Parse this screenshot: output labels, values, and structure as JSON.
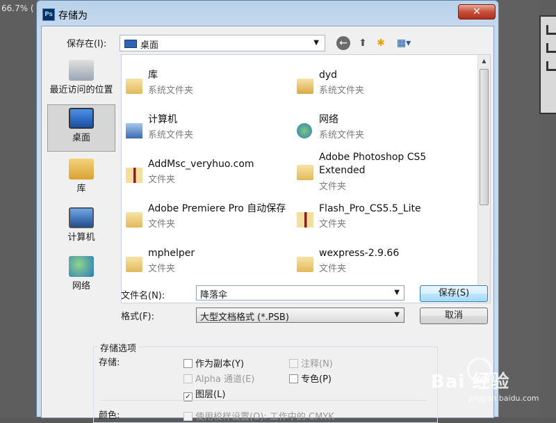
{
  "background": {
    "zoom_text": "66.7% (",
    "colors": {
      "ps_bg": "#5e5e5e"
    }
  },
  "dialog": {
    "icon_text": "Ps",
    "title": "存储为",
    "close_glyph": "✕",
    "save_in": {
      "label": "保存在(I):",
      "value": "桌面",
      "arrow": "▼"
    },
    "nav": {
      "back": "←",
      "up": "⬆",
      "new_folder": "✱",
      "views": "▦▾"
    },
    "places": [
      {
        "label": "最近访问的位置",
        "icon": "recent-places-icon"
      },
      {
        "label": "桌面",
        "icon": "desktop-icon",
        "active": true
      },
      {
        "label": "库",
        "icon": "library-icon"
      },
      {
        "label": "计算机",
        "icon": "computer-icon"
      },
      {
        "label": "网络",
        "icon": "network-icon"
      }
    ],
    "files": [
      {
        "name": "库",
        "type": "系统文件夹",
        "icon": "library-folder-icon"
      },
      {
        "name": "dyd",
        "type": "系统文件夹",
        "icon": "user-folder-icon"
      },
      {
        "name": "计算机",
        "type": "系统文件夹",
        "icon": "computer-icon"
      },
      {
        "name": "网络",
        "type": "系统文件夹",
        "icon": "network-icon"
      },
      {
        "name": "AddMsc_veryhuo.com",
        "type": "文件夹",
        "icon": "folder-icon"
      },
      {
        "name": "Adobe Photoshop CS5 Extended",
        "type": "文件夹",
        "icon": "folder-icon"
      },
      {
        "name": "Adobe Premiere Pro 自动保存",
        "type": "文件夹",
        "icon": "folder-icon"
      },
      {
        "name": "Flash_Pro_CS5.5_Lite",
        "type": "文件夹",
        "icon": "folder-icon"
      },
      {
        "name": "mphelper",
        "type": "文件夹",
        "icon": "folder-icon"
      },
      {
        "name": "wexpress-2.9.66",
        "type": "文件夹",
        "icon": "folder-icon"
      }
    ],
    "scroll": {
      "up": "▲",
      "down": "▼"
    },
    "filename": {
      "label": "文件名(N):",
      "value": "降落伞",
      "arrow": "▼"
    },
    "format": {
      "label": "格式(F):",
      "value": "大型文档格式 (*.PSB)",
      "arrow": "▼"
    },
    "buttons": {
      "save": "保存(S)",
      "cancel": "取消"
    },
    "options": {
      "group_title": "存储选项",
      "save_label": "存储:",
      "as_copy": "作为副本(Y)",
      "notes": "注释(N)",
      "alpha": "Alpha 通道(E)",
      "spot": "专色(P)",
      "layers": "图层(L)",
      "layers_check": "✓",
      "color_label": "颜色:",
      "proof": "使用校样设置(O): 工作中的 CMYK"
    }
  },
  "watermark": {
    "brand": "Bai 经验",
    "url": "jingyan.baidu.com"
  }
}
